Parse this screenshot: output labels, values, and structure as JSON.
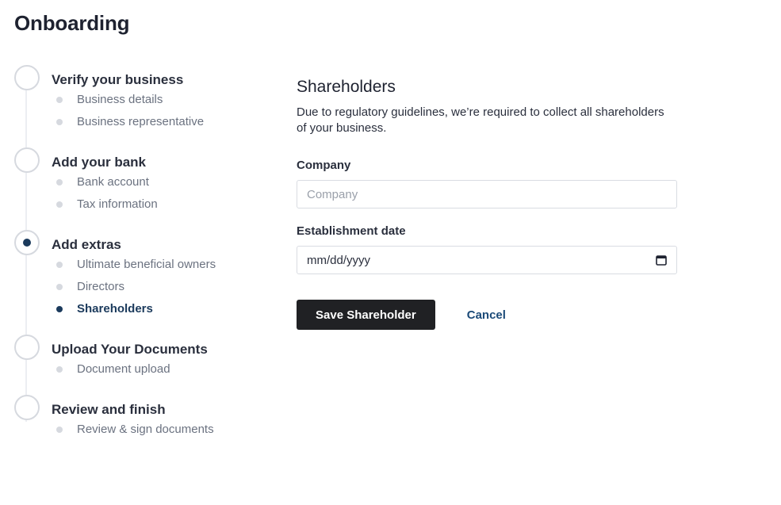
{
  "page": {
    "title": "Onboarding"
  },
  "steps": [
    {
      "title": "Verify your business",
      "status": "pending",
      "substeps": [
        {
          "label": "Business details",
          "active": false
        },
        {
          "label": "Business representative",
          "active": false
        }
      ]
    },
    {
      "title": "Add your bank",
      "status": "pending",
      "substeps": [
        {
          "label": "Bank account",
          "active": false
        },
        {
          "label": "Tax information",
          "active": false
        }
      ]
    },
    {
      "title": "Add extras",
      "status": "active",
      "substeps": [
        {
          "label": "Ultimate beneficial owners",
          "active": false
        },
        {
          "label": "Directors",
          "active": false
        },
        {
          "label": "Shareholders",
          "active": true
        }
      ]
    },
    {
      "title": "Upload Your Documents",
      "status": "pending",
      "substeps": [
        {
          "label": "Document upload",
          "active": false
        }
      ]
    },
    {
      "title": "Review and finish",
      "status": "pending",
      "substeps": [
        {
          "label": "Review & sign documents",
          "active": false
        }
      ]
    }
  ],
  "form": {
    "title": "Shareholders",
    "description": "Due to regulatory guidelines, we’re required to collect all shareholders of your business.",
    "company_label": "Company",
    "company_placeholder": "Company",
    "company_value": "",
    "date_label": "Establishment date",
    "date_value": "mm/dd/yyyy",
    "save_label": "Save Shareholder",
    "cancel_label": "Cancel"
  },
  "colors": {
    "accent": "#1b3a5c",
    "button": "#202124",
    "link": "#1b4a78"
  },
  "icons": {
    "date_picker": "calendar-icon"
  }
}
